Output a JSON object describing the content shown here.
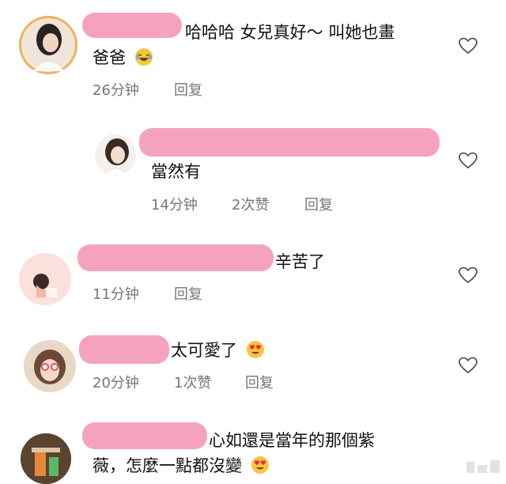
{
  "comments": [
    {
      "text_line1": "哈哈哈 女兒真好～ 叫她也畫",
      "text_line2": "爸爸",
      "time": "26分钟",
      "reply": "回复",
      "emoji": "laughing-emoji"
    },
    {
      "text": "當然有",
      "time": "14分钟",
      "likes": "2次赞",
      "reply": "回复"
    },
    {
      "text": "辛苦了",
      "time": "11分钟",
      "reply": "回复"
    },
    {
      "text": "太可愛了",
      "time": "20分钟",
      "likes": "1次赞",
      "reply": "回复",
      "emoji": "heart-eyes-emoji"
    },
    {
      "text_line1": "心如還是當年的那個紫",
      "text_line2": "薇，怎麼一點都沒變",
      "emoji": "heart-eyes-emoji"
    }
  ],
  "icons": {
    "like": "heart-outline-icon"
  },
  "colors": {
    "redaction": "#f5a3bd",
    "meta_text": "#777777"
  }
}
